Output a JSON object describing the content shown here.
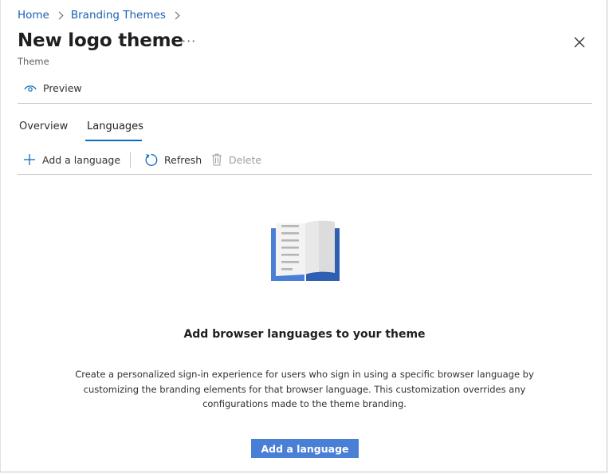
{
  "breadcrumb": {
    "items": [
      "Home",
      "Branding Themes"
    ]
  },
  "header": {
    "title": "New logo theme",
    "more": "···",
    "subtitle": "Theme"
  },
  "command_bar": {
    "preview_label": "Preview"
  },
  "tabs": [
    {
      "label": "Overview",
      "selected": false
    },
    {
      "label": "Languages",
      "selected": true
    }
  ],
  "toolbar": {
    "add_label": "Add a language",
    "refresh_label": "Refresh",
    "delete_label": "Delete",
    "delete_disabled": true
  },
  "empty_state": {
    "icon": "book-icon",
    "title": "Add browser languages to your theme",
    "description": "Create a personalized sign-in experience for users who sign in using a specific browser language by customizing the branding elements for that browser language. This customization overrides any configurations made to the theme branding.",
    "button_label": "Add a language"
  },
  "colors": {
    "accent": "#0f6cbd",
    "primary_button": "#4a7fd6",
    "book_blue": "#2f5fb3",
    "disabled": "#a19f9d"
  }
}
